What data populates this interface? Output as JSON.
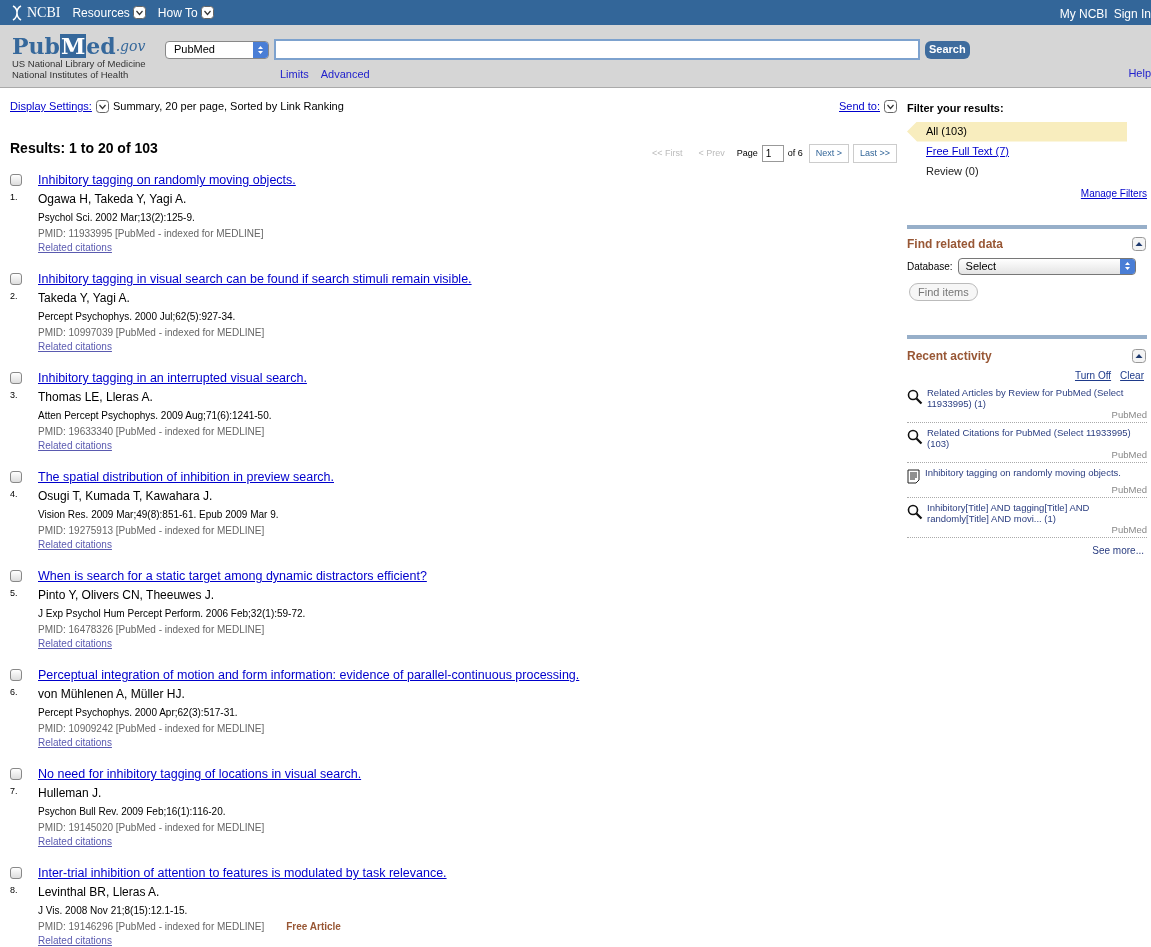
{
  "top_bar": {
    "brand": "NCBI",
    "menus": [
      "Resources",
      "How To"
    ],
    "links": [
      "My NCBI",
      "Sign In"
    ]
  },
  "header": {
    "logo": [
      "Pub",
      "M",
      "ed",
      ".gov"
    ],
    "logo_sub": [
      "US National Library of Medicine",
      "National Institutes of Health"
    ],
    "database": "PubMed",
    "search_button": "Search",
    "links": [
      "Limits",
      "Advanced"
    ],
    "help": "Help"
  },
  "display_settings": {
    "label": "Display Settings:",
    "value": "Summary, 20 per page, Sorted by Link Ranking"
  },
  "send_to": "Send to:",
  "results_heading": "Results: 1 to 20 of 103",
  "pager": {
    "first": "<< First",
    "prev": "< Prev",
    "page_label": "Page",
    "page": "1",
    "of": "of 6",
    "next": "Next >",
    "last": "Last >>"
  },
  "results": [
    {
      "number": "1.",
      "checked": false,
      "title": "Inhibitory tagging on randomly moving objects.",
      "authors": "Ogawa H, Takeda Y, Yagi A.",
      "journal": "Psychol Sci. 2002 Mar;13(2):125-9.",
      "pmid": "PMID: 11933995 [PubMed - indexed for MEDLINE]",
      "related": "Related citations"
    },
    {
      "number": "2.",
      "checked": false,
      "title": "Inhibitory tagging in visual search can be found if search stimuli remain visible.",
      "authors": "Takeda Y, Yagi A.",
      "journal": "Percept Psychophys. 2000 Jul;62(5):927-34.",
      "pmid": "PMID: 10997039 [PubMed - indexed for MEDLINE]",
      "related": "Related citations"
    },
    {
      "number": "3.",
      "checked": false,
      "title": "Inhibitory tagging in an interrupted visual search.",
      "authors": "Thomas LE, Lleras A.",
      "journal": "Atten Percept Psychophys. 2009 Aug;71(6):1241-50.",
      "pmid": "PMID: 19633340 [PubMed - indexed for MEDLINE]",
      "related": "Related citations"
    },
    {
      "number": "4.",
      "checked": false,
      "title": "The spatial distribution of inhibition in preview search.",
      "authors": "Osugi T, Kumada T, Kawahara J.",
      "journal": "Vision Res. 2009 Mar;49(8):851-61. Epub 2009 Mar 9.",
      "pmid": "PMID: 19275913 [PubMed - indexed for MEDLINE]",
      "related": "Related citations"
    },
    {
      "number": "5.",
      "checked": false,
      "title": "When is search for a static target among dynamic distractors efficient?",
      "authors": "Pinto Y, Olivers CN, Theeuwes J.",
      "journal": "J Exp Psychol Hum Percept Perform. 2006 Feb;32(1):59-72.",
      "pmid": "PMID: 16478326 [PubMed - indexed for MEDLINE]",
      "related": "Related citations"
    },
    {
      "number": "6.",
      "checked": false,
      "title": "Perceptual integration of motion and form information: evidence of parallel-continuous processing.",
      "authors": "von Mühlenen A, Müller HJ.",
      "journal": "Percept Psychophys. 2000 Apr;62(3):517-31.",
      "pmid": "PMID: 10909242 [PubMed - indexed for MEDLINE]",
      "related": "Related citations"
    },
    {
      "number": "7.",
      "checked": false,
      "title": "No need for inhibitory tagging of locations in visual search.",
      "authors": "Hulleman J.",
      "journal": "Psychon Bull Rev. 2009 Feb;16(1):116-20.",
      "pmid": "PMID: 19145020 [PubMed - indexed for MEDLINE]",
      "related": "Related citations"
    },
    {
      "number": "8.",
      "checked": false,
      "title": "Inter-trial inhibition of attention to features is modulated by task relevance.",
      "authors": "Levinthal BR, Lleras A.",
      "journal": "J Vis. 2008 Nov 21;8(15):12.1-15.",
      "pmid": "PMID: 19146296 [PubMed - indexed for MEDLINE]",
      "badge": "Free Article",
      "related": "Related citations"
    }
  ],
  "filters": {
    "title": "Filter your results:",
    "items": [
      {
        "label": "All (103)",
        "selected": true
      },
      {
        "label": "Free Full Text (7)",
        "selected": false
      },
      {
        "label": "Review (0)",
        "selected": false,
        "disabled": true
      }
    ],
    "manage": "Manage Filters"
  },
  "find_related": {
    "title": "Find related data",
    "database_label": "Database:",
    "database": "Select",
    "button": "Find items"
  },
  "recent_activity": {
    "title": "Recent activity",
    "actions": [
      "Turn Off",
      "Clear"
    ],
    "items": [
      {
        "kind": "search",
        "text": "Related Articles by Review for PubMed (Select 11933995) (1)",
        "db": "PubMed"
      },
      {
        "kind": "search",
        "text": "Related Citations for PubMed (Select 11933995) (103)",
        "db": "PubMed"
      },
      {
        "kind": "document",
        "text": "Inhibitory tagging on randomly moving objects.",
        "db": "PubMed"
      },
      {
        "kind": "search",
        "text": "Inhibitory[Title] AND tagging[Title] AND randomly[Title] AND movi... (1)",
        "db": "PubMed"
      }
    ],
    "more": "See more..."
  }
}
